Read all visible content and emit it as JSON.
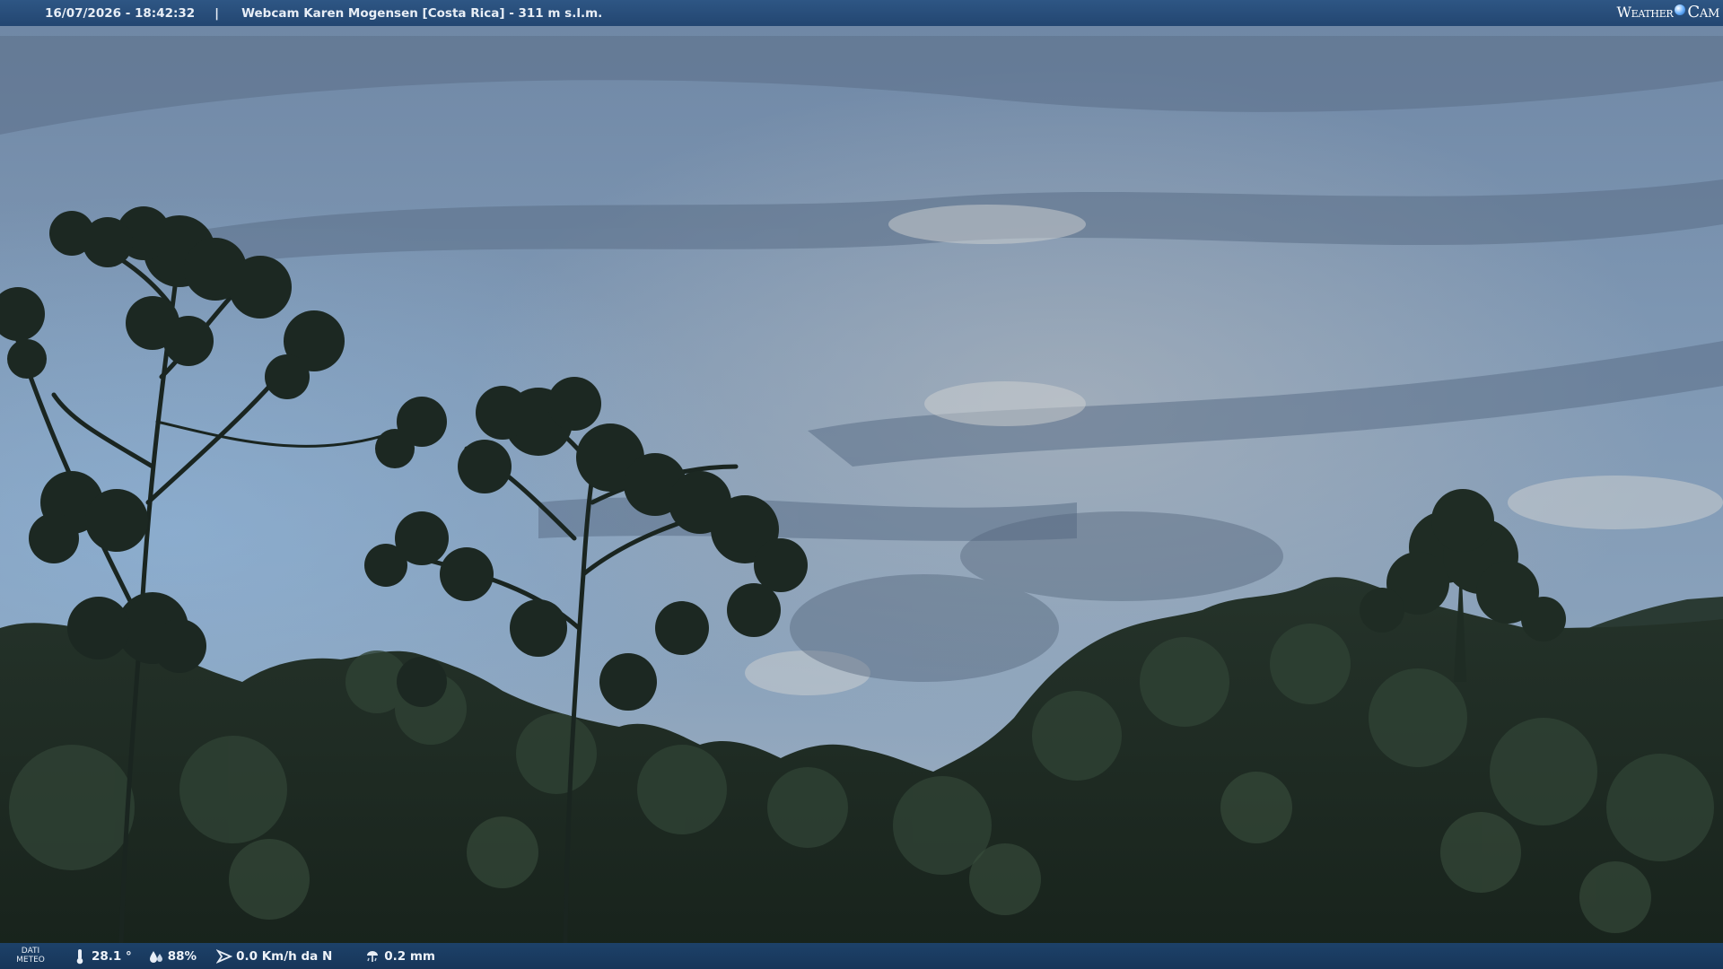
{
  "header": {
    "datetime": "16/07/2026 - 18:42:32",
    "separator": "|",
    "title": "Webcam Karen Mogensen [Costa Rica]  - 311 m s.l.m.",
    "logo_left": "Weather",
    "logo_right": "Cam"
  },
  "footer": {
    "label_line1": "DATI",
    "label_line2": "METEO",
    "temperature": "28.1 °",
    "humidity": "88%",
    "wind": "0.0 Km/h da N",
    "rain": "0.2 mm"
  },
  "icons": {
    "temperature": "thermometer-icon",
    "humidity": "droplets-icon",
    "wind": "wind-icon",
    "rain": "rain-gauge-icon"
  },
  "colors": {
    "header_bar": "#2a4f7c",
    "footer_bar": "#1b3d64",
    "sky_top": "#7d96b3",
    "sky_mid": "#8aa6c2",
    "forest": "#1d2a22"
  }
}
